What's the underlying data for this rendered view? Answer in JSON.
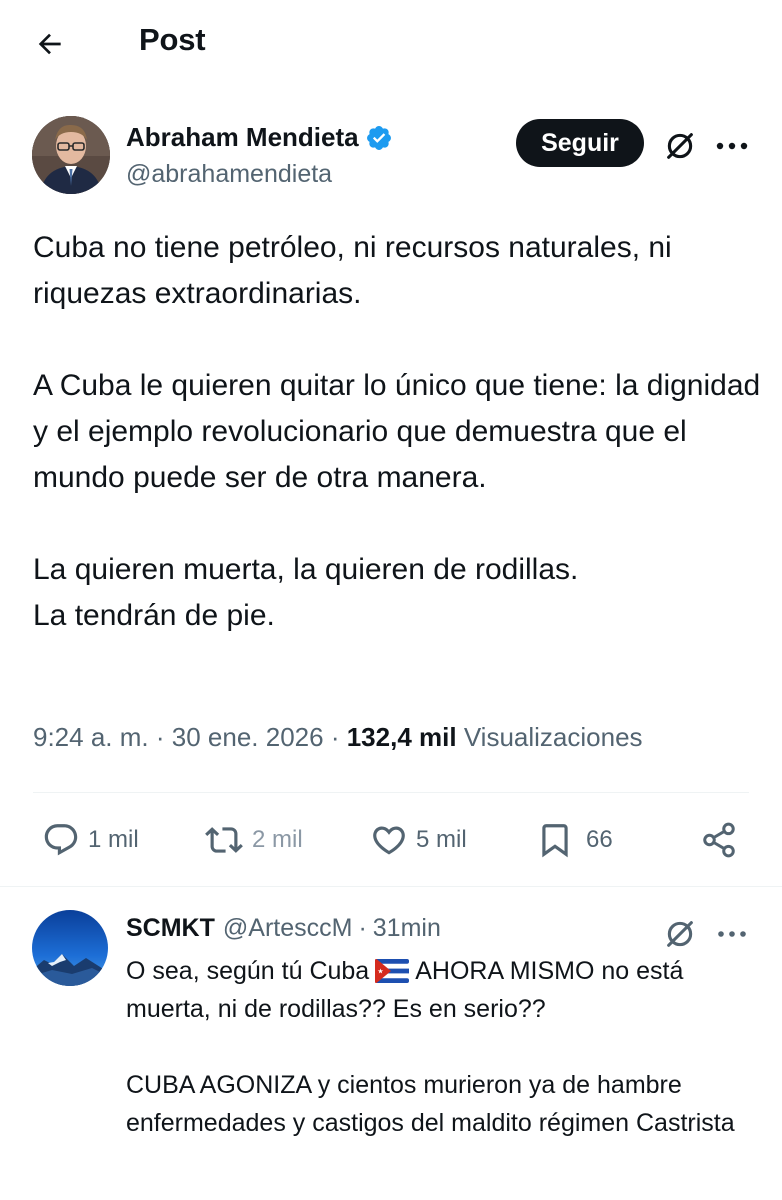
{
  "header": {
    "title": "Post",
    "back_icon": "arrow-left-icon"
  },
  "author": {
    "name": "Abraham Mendieta",
    "handle": "@abrahamendieta",
    "verified": true,
    "follow_label": "Seguir"
  },
  "tweet": {
    "paragraphs": [
      "Cuba no tiene petróleo, ni recursos naturales, ni riquezas extraordinarias.",
      "A Cuba le quieren quitar lo único que tiene: la dignidad y el ejemplo revolucionario que demuestra que el mundo puede ser de otra manera.",
      "La quieren muerta, la quieren de rodillas.",
      "La tendrán de pie."
    ],
    "time": "9:24 a. m.",
    "separator": "·",
    "date": "30 ene. 2026",
    "views_count": "132,4 mil",
    "views_label": "Visualizaciones"
  },
  "actions": {
    "replies": "1 mil",
    "reposts": "2 mil",
    "likes": "5 mil",
    "bookmarks": "66"
  },
  "reply": {
    "name": "SCMKT",
    "handle": "@ArtesccM",
    "separator": "·",
    "time": "31min",
    "text_before_flag": "O sea, según tú Cuba",
    "text_after_flag": "AHORA MISMO no está muerta, ni de rodillas??  Es en serio??",
    "paragraph2": "CUBA AGONIZA y cientos murieron ya de hambre  enfermedades y castigos del maldito régimen Castrista"
  },
  "colors": {
    "text": "#0f1419",
    "muted": "#536471",
    "verified": "#1d9bf0",
    "divider": "#eff3f4"
  }
}
